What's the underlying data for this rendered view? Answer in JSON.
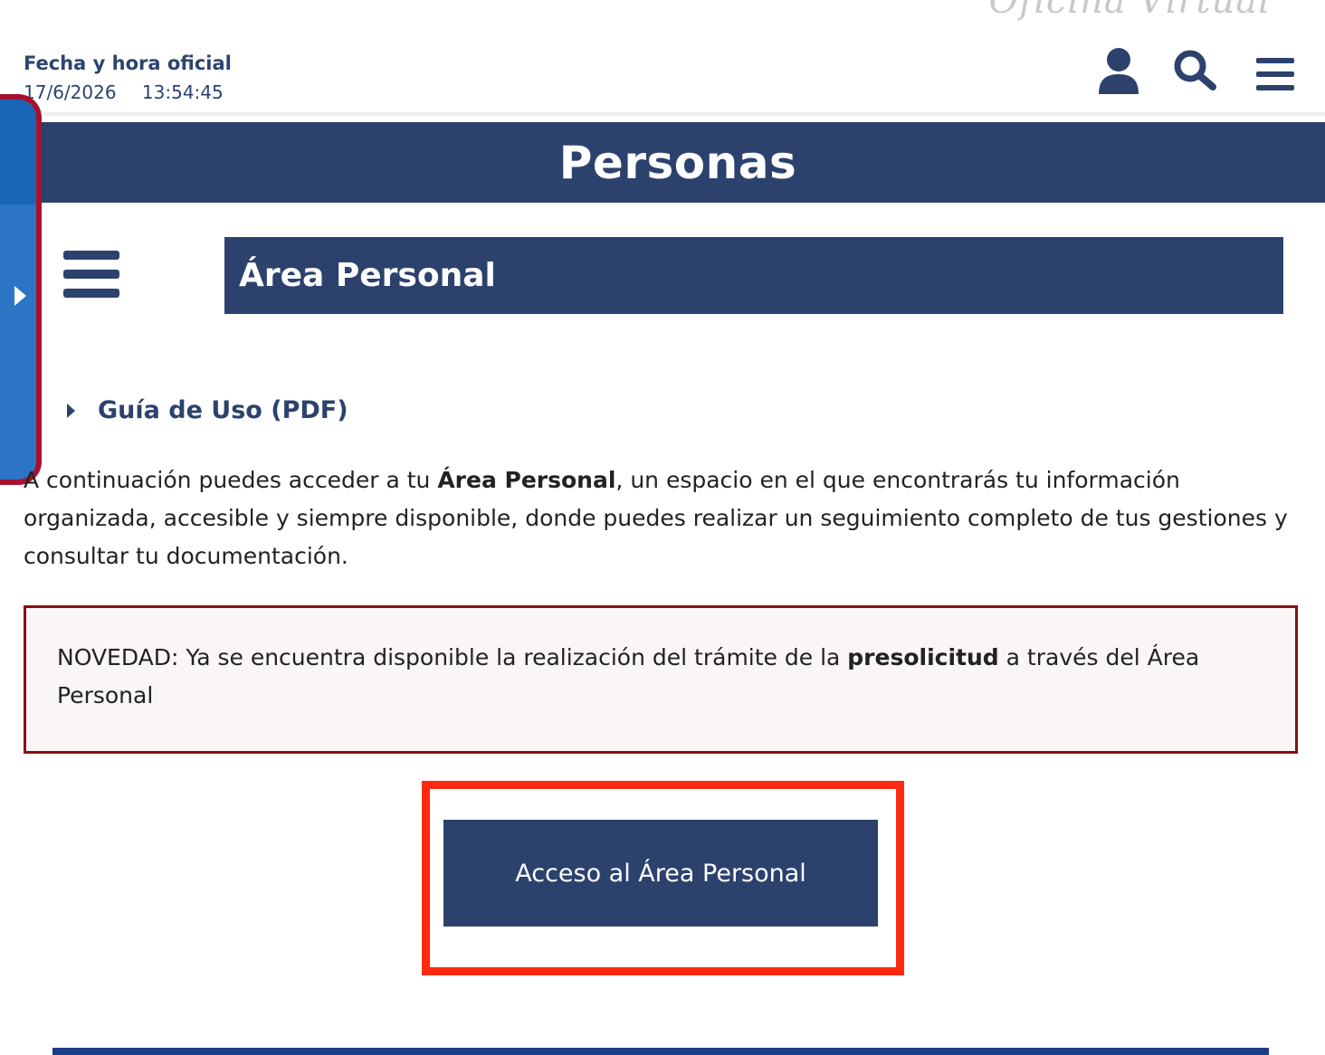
{
  "watermark": "Oficina Virtual",
  "header": {
    "clock_label": "Fecha y hora oficial",
    "date": "17/6/2026",
    "time": "13:54:45",
    "icons": [
      "user-icon",
      "search-icon",
      "hamburger-menu-icon"
    ]
  },
  "banner": {
    "title": "Personas"
  },
  "side_tab": {
    "icon": "caret-right-icon"
  },
  "section": {
    "title": "Área Personal",
    "menu_icon": "hamburger-menu-icon"
  },
  "guide": {
    "label": "Guía de Uso (PDF)"
  },
  "intro": {
    "before": "A continuación puedes acceder a tu ",
    "bold": "Área Personal",
    "after": ", un espacio en el que encontrarás tu información organizada, accesible y siempre disponible, donde puedes realizar un seguimiento completo de tus gestiones y consultar tu documentación."
  },
  "notice": {
    "before": "NOVEDAD: Ya se encuentra disponible la realización del trámite de la ",
    "bold": "presolicitud",
    "after": " a través del Área Personal"
  },
  "access_button": {
    "label": "Acceso al Área Personal"
  },
  "colors": {
    "primary_navy": "#2c426d",
    "side_tab_blue": "#2c74c4",
    "side_tab_border": "#a8112e",
    "notice_border": "#8b0d14",
    "highlight_red": "#ff2a10"
  }
}
